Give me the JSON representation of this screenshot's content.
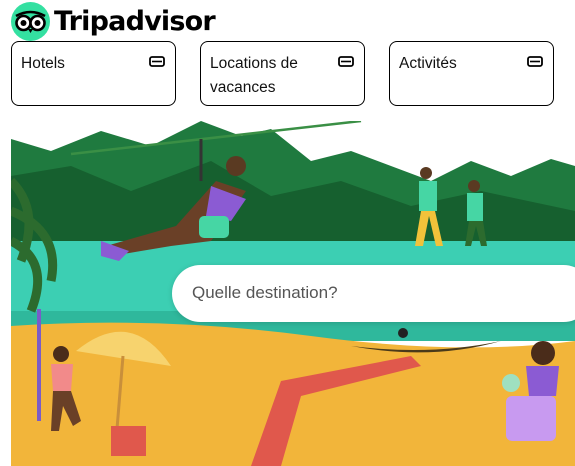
{
  "header": {
    "brand": "Tripadvisor"
  },
  "categories": [
    {
      "label": "Hotels",
      "icon": "ticket-icon"
    },
    {
      "label": "Locations de vacances",
      "icon": "ticket-icon"
    },
    {
      "label": "Activités",
      "icon": "ticket-icon"
    }
  ],
  "search": {
    "placeholder": "Quelle destination?"
  },
  "colors": {
    "brand_green": "#34e0a1",
    "sand": "#f2b53a",
    "jungle": "#1f7a3f",
    "lagoon": "#3ccfb3"
  }
}
